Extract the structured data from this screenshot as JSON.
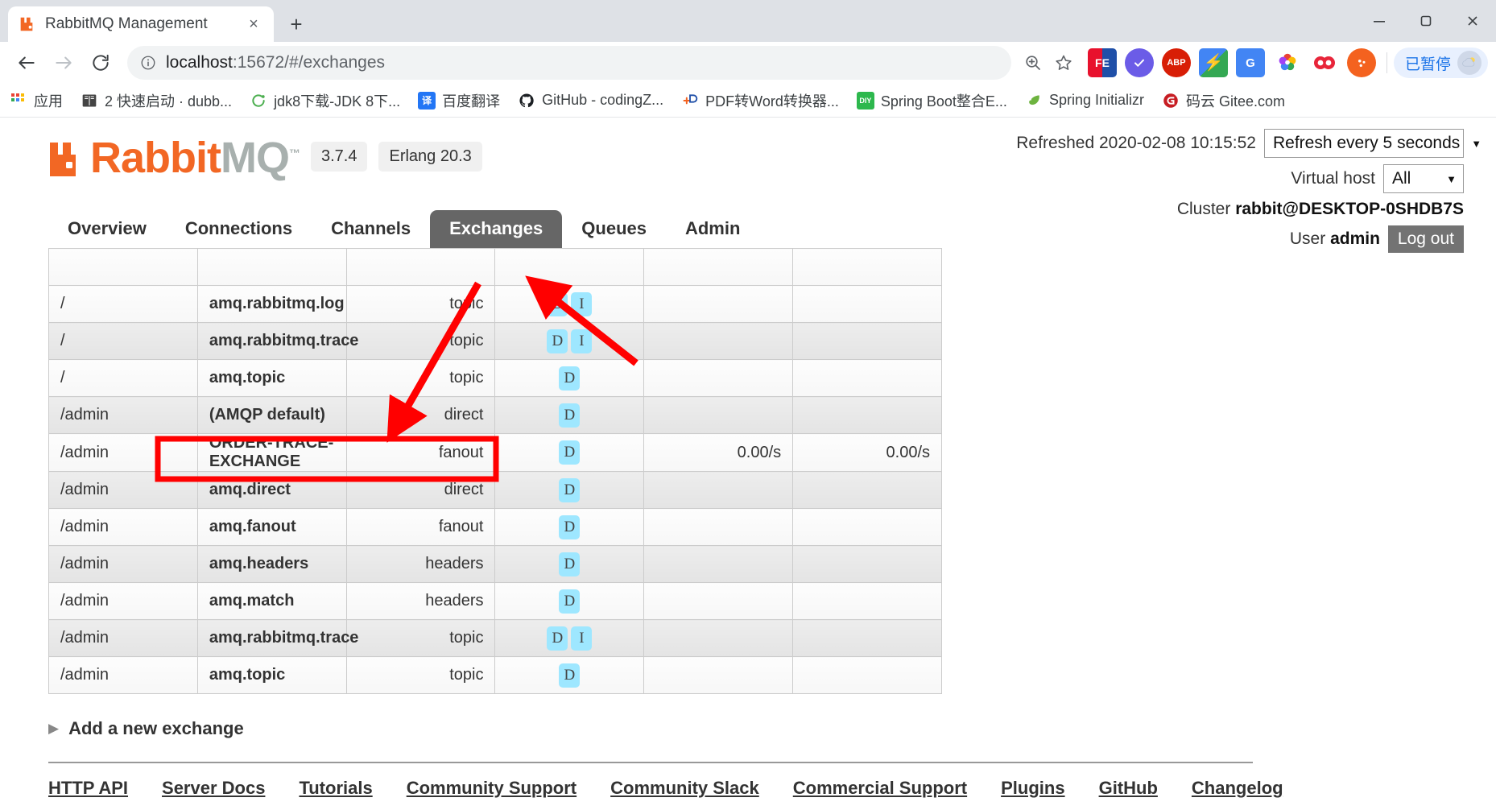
{
  "browser": {
    "tab": {
      "title": "RabbitMQ Management",
      "favicon": "rabbitmq-icon",
      "close": "×"
    },
    "new_tab": "+",
    "window_controls": {
      "minimize": "minimize-icon",
      "maximize": "maximize-icon",
      "close": "close-icon"
    },
    "nav": {
      "back": "back-arrow-icon",
      "forward": "forward-arrow-icon",
      "reload": "reload-icon"
    },
    "omnibox": {
      "info_icon": "info-circle-icon",
      "url_host": "localhost",
      "url_path": ":15672/#/exchanges",
      "zoom_icon": "zoom-in-icon",
      "bookmark_icon": "star-icon"
    },
    "extensions": [
      {
        "name": "fe-extension-icon",
        "label": "FE"
      },
      {
        "name": "check-circle-extension-icon",
        "label": "✓"
      },
      {
        "name": "adblock-plus-icon",
        "label": "ABP"
      },
      {
        "name": "lightning-extension-icon",
        "label": "⚡"
      },
      {
        "name": "google-translate-icon",
        "label": "G"
      },
      {
        "name": "colorful-flower-icon",
        "label": "✿"
      },
      {
        "name": "infinity-extension-icon",
        "label": "∞"
      },
      {
        "name": "orange-circle-extension-icon",
        "label": "⚙"
      }
    ],
    "profile": {
      "paused_label": "已暂停",
      "avatar": "weather-avatar-icon"
    },
    "bookmarks": [
      {
        "label": "应用",
        "icon": "apps-grid-icon"
      },
      {
        "label": "2 快速启动 · dubb...",
        "icon": "book-icon"
      },
      {
        "label": "jdk8下载-JDK 8下...",
        "icon": "java-icon"
      },
      {
        "label": "百度翻译",
        "icon": "baidu-translate-icon"
      },
      {
        "label": "GitHub - codingZ...",
        "icon": "github-icon"
      },
      {
        "label": "PDF转Word转换器...",
        "icon": "pdf-icon"
      },
      {
        "label": "Spring Boot整合E...",
        "icon": "diy-icon"
      },
      {
        "label": "Spring Initializr",
        "icon": "spring-leaf-icon"
      },
      {
        "label": "码云 Gitee.com",
        "icon": "gitee-icon"
      }
    ]
  },
  "app": {
    "logo": {
      "rabbit": "Rabbit",
      "mq": "MQ",
      "tm": "™"
    },
    "version_badge": "3.7.4",
    "erlang_badge": "Erlang 20.3",
    "refreshed_label": "Refreshed 2020-02-08 10:15:52",
    "refresh_select": {
      "value": "Refresh every 5 seconds",
      "caret": "▼"
    },
    "vhost_label": "Virtual host",
    "vhost_select": {
      "value": "All",
      "caret": "▼"
    },
    "cluster_label": "Cluster",
    "cluster_value": "rabbit@DESKTOP-0SHDB7S",
    "user_label": "User",
    "user_value": "admin",
    "logout_label": "Log out",
    "tabs": [
      {
        "label": "Overview",
        "active": false
      },
      {
        "label": "Connections",
        "active": false
      },
      {
        "label": "Channels",
        "active": false
      },
      {
        "label": "Exchanges",
        "active": true
      },
      {
        "label": "Queues",
        "active": false
      },
      {
        "label": "Admin",
        "active": false
      }
    ],
    "exchanges": [
      {
        "vhost": "/",
        "name": "amq.rabbitmq.log",
        "type": "topic",
        "features": [
          "D",
          "I"
        ],
        "in": "",
        "out": "",
        "highlight": false
      },
      {
        "vhost": "/",
        "name": "amq.rabbitmq.trace",
        "type": "topic",
        "features": [
          "D",
          "I"
        ],
        "in": "",
        "out": "",
        "highlight": false
      },
      {
        "vhost": "/",
        "name": "amq.topic",
        "type": "topic",
        "features": [
          "D"
        ],
        "in": "",
        "out": "",
        "highlight": false
      },
      {
        "vhost": "/admin",
        "name": "(AMQP default)",
        "type": "direct",
        "features": [
          "D"
        ],
        "in": "",
        "out": "",
        "highlight": false
      },
      {
        "vhost": "/admin",
        "name": "ORDER-TRACE-EXCHANGE",
        "type": "fanout",
        "features": [
          "D"
        ],
        "in": "0.00/s",
        "out": "0.00/s",
        "highlight": true
      },
      {
        "vhost": "/admin",
        "name": "amq.direct",
        "type": "direct",
        "features": [
          "D"
        ],
        "in": "",
        "out": "",
        "highlight": false
      },
      {
        "vhost": "/admin",
        "name": "amq.fanout",
        "type": "fanout",
        "features": [
          "D"
        ],
        "in": "",
        "out": "",
        "highlight": false
      },
      {
        "vhost": "/admin",
        "name": "amq.headers",
        "type": "headers",
        "features": [
          "D"
        ],
        "in": "",
        "out": "",
        "highlight": false
      },
      {
        "vhost": "/admin",
        "name": "amq.match",
        "type": "headers",
        "features": [
          "D"
        ],
        "in": "",
        "out": "",
        "highlight": false
      },
      {
        "vhost": "/admin",
        "name": "amq.rabbitmq.trace",
        "type": "topic",
        "features": [
          "D",
          "I"
        ],
        "in": "",
        "out": "",
        "highlight": false
      },
      {
        "vhost": "/admin",
        "name": "amq.topic",
        "type": "topic",
        "features": [
          "D"
        ],
        "in": "",
        "out": "",
        "highlight": false
      }
    ],
    "add_exchange": {
      "label": "Add a new exchange",
      "triangle": "▶"
    },
    "footer_links": [
      "HTTP API",
      "Server Docs",
      "Tutorials",
      "Community Support",
      "Community Slack",
      "Commercial Support",
      "Plugins",
      "GitHub",
      "Changelog"
    ]
  },
  "annotations": {
    "highlight_color": "#ff0000",
    "arrow_color": "#ff0000",
    "arrows": 2,
    "box_target": "ORDER-TRACE-EXCHANGE"
  }
}
